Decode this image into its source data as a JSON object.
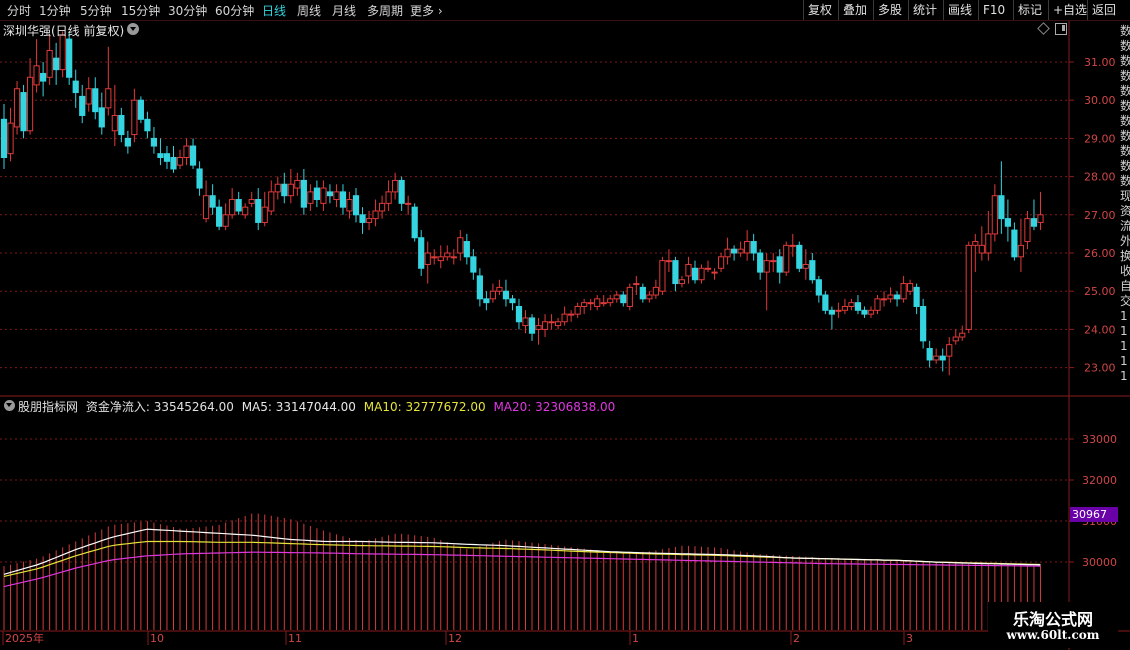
{
  "toolbar": {
    "periods": [
      "分时",
      "1分钟",
      "5分钟",
      "15分钟",
      "30分钟",
      "60分钟",
      "日线",
      "周线",
      "月线",
      "多周期",
      "更多"
    ],
    "active_period": "日线",
    "actions": [
      "复权",
      "叠加",
      "多股",
      "统计",
      "画线",
      "F10",
      "标记",
      "+自选",
      "返回"
    ]
  },
  "main": {
    "title": "深圳华强(日线 前复权)",
    "price_ticks": [
      "31.00",
      "30.00",
      "29.00",
      "28.00",
      "27.00",
      "26.00",
      "25.00",
      "24.00",
      "23.00"
    ]
  },
  "indicator": {
    "name": "股朋指标网",
    "main_label": "资金净流入: 33545264.00",
    "ma5_label": "MA5: 33147044.00",
    "ma10_label": "MA10: 32777672.00",
    "ma20_label": "MA20: 32306838.00",
    "ticks": [
      "33000",
      "32000",
      "31000",
      "30000"
    ],
    "value_tag": "30967",
    "colors": {
      "bars": "#d23c3c",
      "ma5": "#ffffff",
      "ma10": "#e6e33a",
      "ma20": "#e038e0"
    }
  },
  "x_axis": {
    "labels": [
      "2025年",
      "10",
      "11",
      "12",
      "1",
      "2",
      "3"
    ]
  },
  "right_strip": [
    "数",
    "数",
    "数",
    "数",
    "数",
    "数",
    "数",
    "数",
    "数",
    "数",
    "数",
    "现",
    "资",
    "流",
    "外",
    "换",
    "收",
    "自",
    "交",
    "1",
    "1",
    "1",
    "1",
    "1"
  ],
  "watermark": {
    "title": "乐淘公式网",
    "url": "www.60lt.com"
  },
  "colors": {
    "up": "#e03a3a",
    "down": "#34d4e0",
    "grid": "#7a1a1a",
    "axis_text": "#d04646"
  },
  "chart_data": {
    "type": "candlestick",
    "candles": [
      [
        29.5,
        28.5,
        29.9,
        28.2
      ],
      [
        28.6,
        29.4,
        29.8,
        28.4
      ],
      [
        29.3,
        30.3,
        30.5,
        29.1
      ],
      [
        30.2,
        29.2,
        30.4,
        29.0
      ],
      [
        29.2,
        30.6,
        31.1,
        29.1
      ],
      [
        30.4,
        30.9,
        31.6,
        30.2
      ],
      [
        30.7,
        30.5,
        31.0,
        30.1
      ],
      [
        30.6,
        31.3,
        31.7,
        30.4
      ],
      [
        31.1,
        30.8,
        31.5,
        30.4
      ],
      [
        30.8,
        31.7,
        31.8,
        30.6
      ],
      [
        31.6,
        30.6,
        31.8,
        30.4
      ],
      [
        30.5,
        30.2,
        30.8,
        29.8
      ],
      [
        30.1,
        29.6,
        30.4,
        29.4
      ],
      [
        29.9,
        30.3,
        30.6,
        29.7
      ],
      [
        30.3,
        29.7,
        30.6,
        29.5
      ],
      [
        29.8,
        29.3,
        30.2,
        29.1
      ],
      [
        29.8,
        30.3,
        31.4,
        29.6
      ],
      [
        29.2,
        29.6,
        30.4,
        28.8
      ],
      [
        29.6,
        29.1,
        29.8,
        28.9
      ],
      [
        29.0,
        28.8,
        29.2,
        28.6
      ],
      [
        29.1,
        30.0,
        30.3,
        28.9
      ],
      [
        30.0,
        29.5,
        30.1,
        29.4
      ],
      [
        29.5,
        29.2,
        29.7,
        29.0
      ],
      [
        29.0,
        28.8,
        29.3,
        28.6
      ],
      [
        28.6,
        28.5,
        29.0,
        28.3
      ],
      [
        28.6,
        28.4,
        28.8,
        28.2
      ],
      [
        28.5,
        28.2,
        28.8,
        28.1
      ],
      [
        28.3,
        28.5,
        28.7,
        28.2
      ],
      [
        28.5,
        28.8,
        29.0,
        28.3
      ],
      [
        28.8,
        28.3,
        29.0,
        28.2
      ],
      [
        28.2,
        27.7,
        28.4,
        27.5
      ],
      [
        26.9,
        27.5,
        27.9,
        26.8
      ],
      [
        27.5,
        27.2,
        27.8,
        27.0
      ],
      [
        27.2,
        26.7,
        27.4,
        26.6
      ],
      [
        26.7,
        27.0,
        27.3,
        26.6
      ],
      [
        27.0,
        27.4,
        27.7,
        26.9
      ],
      [
        27.4,
        27.1,
        27.6,
        27.0
      ],
      [
        27.0,
        27.2,
        27.3,
        26.9
      ],
      [
        27.3,
        27.4,
        27.6,
        27.2
      ],
      [
        27.4,
        26.8,
        27.7,
        26.6
      ],
      [
        26.8,
        27.2,
        27.6,
        26.7
      ],
      [
        27.1,
        27.6,
        27.9,
        27.0
      ],
      [
        27.6,
        27.8,
        28.0,
        27.4
      ],
      [
        27.8,
        27.5,
        28.1,
        27.3
      ],
      [
        27.5,
        27.8,
        28.2,
        27.3
      ],
      [
        27.7,
        27.9,
        28.1,
        27.5
      ],
      [
        27.9,
        27.2,
        28.2,
        27.0
      ],
      [
        27.3,
        27.6,
        27.8,
        27.1
      ],
      [
        27.7,
        27.4,
        27.9,
        27.2
      ],
      [
        27.3,
        27.7,
        27.9,
        27.1
      ],
      [
        27.6,
        27.5,
        27.8,
        27.3
      ],
      [
        27.4,
        27.6,
        27.8,
        27.2
      ],
      [
        27.6,
        27.2,
        27.8,
        27.0
      ],
      [
        27.1,
        27.4,
        27.6,
        26.9
      ],
      [
        27.5,
        27.0,
        27.7,
        26.8
      ],
      [
        27.0,
        26.8,
        27.2,
        26.5
      ],
      [
        26.8,
        26.9,
        27.1,
        26.6
      ],
      [
        26.9,
        27.1,
        27.4,
        26.7
      ],
      [
        27.1,
        27.3,
        27.5,
        26.9
      ],
      [
        27.3,
        27.6,
        27.9,
        27.1
      ],
      [
        27.6,
        27.9,
        28.1,
        27.4
      ],
      [
        27.9,
        27.3,
        28.0,
        27.1
      ],
      [
        27.3,
        27.3,
        27.5,
        27.0
      ],
      [
        27.2,
        26.4,
        27.3,
        26.3
      ],
      [
        26.4,
        25.6,
        26.6,
        25.4
      ],
      [
        25.7,
        26.0,
        26.3,
        25.2
      ],
      [
        25.9,
        25.9,
        26.1,
        25.7
      ],
      [
        25.8,
        25.9,
        26.2,
        25.6
      ],
      [
        25.9,
        26.0,
        26.2,
        25.8
      ],
      [
        25.9,
        25.9,
        26.1,
        25.7
      ],
      [
        26.0,
        26.4,
        26.6,
        25.8
      ],
      [
        26.3,
        25.9,
        26.5,
        25.7
      ],
      [
        25.9,
        25.5,
        26.1,
        25.3
      ],
      [
        25.4,
        24.8,
        25.6,
        24.6
      ],
      [
        24.8,
        24.7,
        25.0,
        24.5
      ],
      [
        24.8,
        25.0,
        25.2,
        24.7
      ],
      [
        25.0,
        25.1,
        25.3,
        24.9
      ],
      [
        25.0,
        24.8,
        25.3,
        24.6
      ],
      [
        24.8,
        24.7,
        24.9,
        24.5
      ],
      [
        24.6,
        24.2,
        24.8,
        24.0
      ],
      [
        24.1,
        24.3,
        24.5,
        23.9
      ],
      [
        24.3,
        23.9,
        24.4,
        23.7
      ],
      [
        24.0,
        24.1,
        24.3,
        23.6
      ],
      [
        24.0,
        24.2,
        24.4,
        23.8
      ],
      [
        24.2,
        24.2,
        24.4,
        24.0
      ],
      [
        24.1,
        24.2,
        24.3,
        24.0
      ],
      [
        24.2,
        24.4,
        24.6,
        24.1
      ],
      [
        24.4,
        24.4,
        24.5,
        24.2
      ],
      [
        24.4,
        24.6,
        24.7,
        24.3
      ],
      [
        24.6,
        24.7,
        24.8,
        24.4
      ],
      [
        24.7,
        24.7,
        24.8,
        24.5
      ],
      [
        24.6,
        24.8,
        24.9,
        24.5
      ],
      [
        24.7,
        24.7,
        24.9,
        24.6
      ],
      [
        24.7,
        24.8,
        24.9,
        24.6
      ],
      [
        24.8,
        24.9,
        25.0,
        24.7
      ],
      [
        24.9,
        24.7,
        25.0,
        24.6
      ],
      [
        24.6,
        25.1,
        25.2,
        24.5
      ],
      [
        25.2,
        25.2,
        25.4,
        24.9
      ],
      [
        25.1,
        24.8,
        25.2,
        24.7
      ],
      [
        24.8,
        24.9,
        25.0,
        24.7
      ],
      [
        24.9,
        25.1,
        25.3,
        24.8
      ],
      [
        25.0,
        25.8,
        25.9,
        24.9
      ],
      [
        25.8,
        25.8,
        26.1,
        25.5
      ],
      [
        25.8,
        25.2,
        25.9,
        25.0
      ],
      [
        25.2,
        25.3,
        25.4,
        25.1
      ],
      [
        25.4,
        25.7,
        25.9,
        25.2
      ],
      [
        25.6,
        25.3,
        25.8,
        25.2
      ],
      [
        25.3,
        25.6,
        25.7,
        25.2
      ],
      [
        25.6,
        25.6,
        25.8,
        25.5
      ],
      [
        25.5,
        25.5,
        25.6,
        25.3
      ],
      [
        25.6,
        25.9,
        26.0,
        25.5
      ],
      [
        25.9,
        26.1,
        26.4,
        25.7
      ],
      [
        26.1,
        26.0,
        26.2,
        25.8
      ],
      [
        26.0,
        26.1,
        26.3,
        25.9
      ],
      [
        26.0,
        26.3,
        26.6,
        25.8
      ],
      [
        26.3,
        26.0,
        26.5,
        25.8
      ],
      [
        26.0,
        25.5,
        26.1,
        25.3
      ],
      [
        25.5,
        25.8,
        26.0,
        24.5
      ],
      [
        25.8,
        25.8,
        26.0,
        25.5
      ],
      [
        25.9,
        25.5,
        26.1,
        25.2
      ],
      [
        25.5,
        26.2,
        26.3,
        25.4
      ],
      [
        26.2,
        26.2,
        26.5,
        25.9
      ],
      [
        26.2,
        25.6,
        26.3,
        25.5
      ],
      [
        25.6,
        25.7,
        26.1,
        25.3
      ],
      [
        25.8,
        25.3,
        26.0,
        25.2
      ],
      [
        25.3,
        24.9,
        25.4,
        24.7
      ],
      [
        24.9,
        24.5,
        25.0,
        24.4
      ],
      [
        24.5,
        24.4,
        24.6,
        24.0
      ],
      [
        24.5,
        24.5,
        24.7,
        24.3
      ],
      [
        24.5,
        24.6,
        24.8,
        24.4
      ],
      [
        24.6,
        24.7,
        24.8,
        24.5
      ],
      [
        24.7,
        24.5,
        24.9,
        24.4
      ],
      [
        24.5,
        24.4,
        24.6,
        24.3
      ],
      [
        24.4,
        24.5,
        24.6,
        24.3
      ],
      [
        24.5,
        24.8,
        24.9,
        24.4
      ],
      [
        24.8,
        24.8,
        25.0,
        24.6
      ],
      [
        24.8,
        24.9,
        25.1,
        24.7
      ],
      [
        24.9,
        24.8,
        25.0,
        24.6
      ],
      [
        24.8,
        25.2,
        25.4,
        24.7
      ],
      [
        25.0,
        25.2,
        25.3,
        24.9
      ],
      [
        25.1,
        24.6,
        25.2,
        24.4
      ],
      [
        24.6,
        23.7,
        24.8,
        23.5
      ],
      [
        23.5,
        23.2,
        23.7,
        23.0
      ],
      [
        23.2,
        23.3,
        23.5,
        23.1
      ],
      [
        23.3,
        23.2,
        23.5,
        22.9
      ],
      [
        23.3,
        23.6,
        23.8,
        22.8
      ],
      [
        23.7,
        23.8,
        24.0,
        23.6
      ],
      [
        23.8,
        23.9,
        24.1,
        23.7
      ],
      [
        24.0,
        26.2,
        26.3,
        23.9
      ],
      [
        26.2,
        26.3,
        26.5,
        25.5
      ],
      [
        26.0,
        26.2,
        26.7,
        25.8
      ],
      [
        26.0,
        26.5,
        27.1,
        25.8
      ],
      [
        26.5,
        27.5,
        27.8,
        26.3
      ],
      [
        27.5,
        26.9,
        28.4,
        26.5
      ],
      [
        26.9,
        26.7,
        27.4,
        26.3
      ],
      [
        26.6,
        25.9,
        26.8,
        25.8
      ],
      [
        25.9,
        26.2,
        26.9,
        25.5
      ],
      [
        26.3,
        26.9,
        27.1,
        26.1
      ],
      [
        26.9,
        26.7,
        27.4,
        26.6
      ],
      [
        26.8,
        27.0,
        27.6,
        26.6
      ]
    ],
    "indicator_series": {
      "net_inflow": [
        29900,
        30100,
        30500,
        30900,
        31000,
        30800,
        30900,
        31200,
        31050,
        30750,
        30500,
        30700,
        30600,
        30300,
        30550,
        30450,
        30350,
        30250,
        30250,
        30400,
        30350,
        30200,
        30150,
        30100,
        30080,
        30050,
        30000,
        29950,
        29950,
        29900
      ],
      "ma5": [
        29700,
        29950,
        30300,
        30600,
        30800,
        30750,
        30700,
        30650,
        30550,
        30500,
        30500,
        30480,
        30470,
        30430,
        30400,
        30350,
        30300,
        30250,
        30220,
        30200,
        30180,
        30150,
        30100,
        30080,
        30060,
        30040,
        30000,
        29970,
        29950,
        29930
      ],
      "ma10": [
        29650,
        29850,
        30150,
        30400,
        30500,
        30500,
        30480,
        30480,
        30450,
        30420,
        30400,
        30390,
        30380,
        30350,
        30330,
        30300,
        30260,
        30230,
        30200,
        30180,
        30160,
        30130,
        30100,
        30080,
        30060,
        30040,
        30000,
        29980,
        29960,
        29940
      ],
      "ma20": [
        29400,
        29600,
        29850,
        30050,
        30150,
        30200,
        30220,
        30240,
        30230,
        30220,
        30200,
        30190,
        30180,
        30160,
        30140,
        30120,
        30100,
        30080,
        30060,
        30040,
        30020,
        30000,
        29980,
        29960,
        29950,
        29940,
        29930,
        29920,
        29910,
        29900
      ]
    }
  }
}
